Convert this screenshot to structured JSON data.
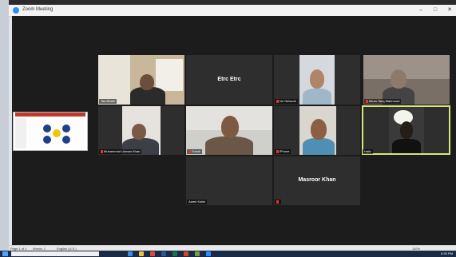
{
  "window": {
    "title": "Zoom Meeting",
    "minimize": "–",
    "maximize": "□",
    "close": "✕"
  },
  "participants": [
    {
      "name": "Tas Bhatti",
      "type": "video"
    },
    {
      "name": "Etrc Etrc",
      "type": "name",
      "label": "Etrc Etrc"
    },
    {
      "name": "No Network",
      "type": "video",
      "muted": true
    },
    {
      "name": "Mirza Tariq Mahmood",
      "type": "video",
      "muted": true
    },
    {
      "name": "Muhammad Usman Khan",
      "type": "video",
      "muted": true
    },
    {
      "name": "Suhail",
      "type": "video",
      "muted": true
    },
    {
      "name": "iPhone",
      "type": "video",
      "muted": true
    },
    {
      "name": "Hafiz",
      "type": "video",
      "active": true
    },
    {
      "name": "Aamir Kabir",
      "type": "name",
      "label": ""
    },
    {
      "name": "",
      "type": "name",
      "label": "Masroor Khan",
      "muted": true
    }
  ],
  "statusbar": {
    "page": "Page 1 of 1",
    "words": "Words: 1",
    "language": "English (U.S.)",
    "zoom": "110%"
  },
  "taskbar": {
    "clock": "6:30 PM"
  },
  "colors": {
    "active_outline": "#d9e57a",
    "mic_muted": "#e0392b",
    "zoom_blue": "#2d8cff"
  }
}
